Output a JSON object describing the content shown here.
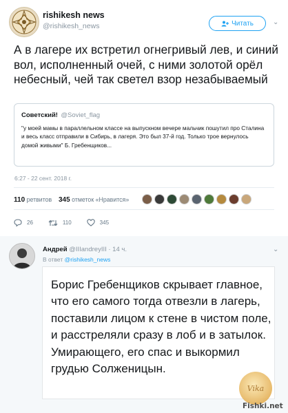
{
  "tweet": {
    "author_name": "rishikesh news",
    "author_handle": "@rishikesh_news",
    "follow_label": "Читать",
    "text": "А в лагере их встретил огнегривый лев, и синий вол, исполненный очей, с ними золотой орёл небесный, чей так светел взор незабываемый",
    "timestamp": "6:27 - 22 сент. 2018 г."
  },
  "quote": {
    "name": "Советский!",
    "handle": "@Soviet_flag",
    "text": "\"у моей мамы в параллельном классе на выпускном вечере мальчик пошутил про Сталина и весь класс отправили в Сибирь, в лагеря. Это был 37-й год. Только трое вернулось домой живыми\" Б. Гребенщиков..."
  },
  "stats": {
    "retweets_count": "110",
    "retweets_label": "ретвитов",
    "likes_count": "345",
    "likes_label": "отметок «Нравится»"
  },
  "actions": {
    "reply_count": "26",
    "retweet_count": "110",
    "like_count": "345"
  },
  "reply": {
    "name": "Андрей",
    "handle": "@IIIandreyIII · 14 ч.",
    "reply_to_prefix": "В ответ",
    "reply_to_handle": "@rishikesh_news",
    "text": "Борис Гребенщиков скрывает главное, что его самого тогда отвезли в лагерь, поставили лицом к стене в чистом поле, и расстреляли сразу в лоб и в затылок. Умирающего, его спас и выкормил грудью Солженицын."
  },
  "branding": {
    "logo_text": "Vika",
    "watermark": "Fishki.net"
  },
  "colors": {
    "accent": "#1da1f2",
    "muted": "#8a96a1",
    "reply_bg": "#f5f8fa"
  }
}
